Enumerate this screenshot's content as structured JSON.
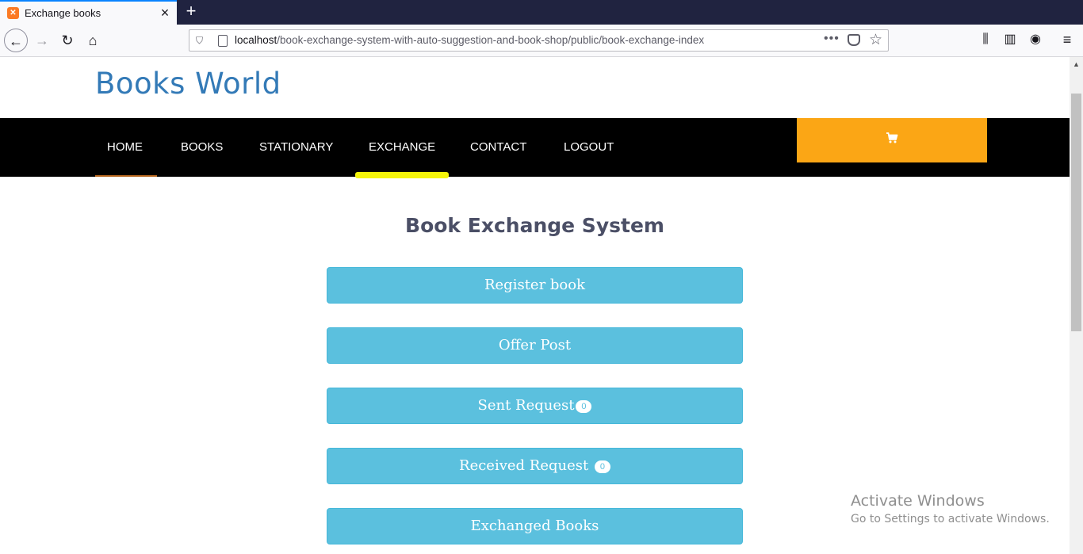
{
  "browser": {
    "tab_title": "Exchange books",
    "url_host": "localhost",
    "url_path": "/book-exchange-system-with-auto-suggestion-and-book-shop/public/book-exchange-index",
    "icons": [
      "back-arrow-icon",
      "forward-arrow-icon",
      "reload-icon",
      "home-icon",
      "shield-icon",
      "page-icon",
      "more-dots-icon",
      "pocket-icon",
      "star-icon",
      "library-icon",
      "sidebar-icon",
      "account-icon",
      "menu-icon"
    ]
  },
  "site": {
    "brand": "Books World",
    "nav": {
      "home": "HOME",
      "books": "BOOKS",
      "stationary": "STATIONARY",
      "exchange": "EXCHANGE",
      "contact": "CONTACT",
      "logout": "LOGOUT"
    },
    "active_nav": "EXCHANGE",
    "colors": {
      "brand": "#337ab7",
      "nav_bg": "#000000",
      "cart_bg": "#fba615",
      "active_underline": "#f5f50a",
      "button_bg": "#5bc0de"
    }
  },
  "main": {
    "heading": "Book Exchange System",
    "buttons": {
      "register": "Register book",
      "offer": "Offer Post",
      "sent": "Sent Request",
      "sent_count": "0",
      "received": "Received Request",
      "received_count": "0",
      "exchanged": "Exchanged Books"
    }
  },
  "watermark": {
    "title": "Activate Windows",
    "subtitle": "Go to Settings to activate Windows."
  }
}
